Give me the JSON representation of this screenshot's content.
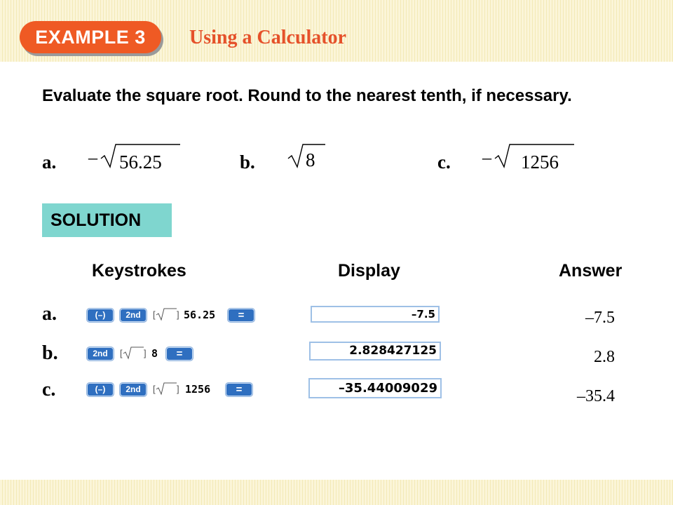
{
  "header": {
    "example_label": "EXAMPLE 3",
    "title": "Using a Calculator"
  },
  "instructions": "Evaluate the square root. Round to the nearest tenth, if necessary.",
  "problems": [
    {
      "letter": "a.",
      "sign": "–",
      "radicand": "56.25"
    },
    {
      "letter": "b.",
      "sign": "",
      "radicand": "8"
    },
    {
      "letter": "c.",
      "sign": "–",
      "radicand": "1256"
    }
  ],
  "solution_label": "SOLUTION",
  "columns": {
    "keystrokes": "Keystrokes",
    "display": "Display",
    "answer": "Answer"
  },
  "rows": [
    {
      "letter": "a.",
      "keys": {
        "neg": "(–)",
        "second": "2nd",
        "bracket_open": "[",
        "bracket_close": "]",
        "number": "56.25",
        "equals": "="
      },
      "display": "–7.5",
      "answer": "–7.5"
    },
    {
      "letter": "b.",
      "keys": {
        "second": "2nd",
        "bracket_open": "[",
        "bracket_close": "]",
        "number": "8",
        "equals": "="
      },
      "display": "2.828427125",
      "answer": "2.8"
    },
    {
      "letter": "c.",
      "keys": {
        "neg": "(–)",
        "second": "2nd",
        "bracket_open": "[",
        "bracket_close": "]",
        "number": "1256",
        "equals": "="
      },
      "display": "–35.44009029",
      "answer": "–35.4"
    }
  ],
  "colors": {
    "accent_orange": "#ef5a24",
    "title_orange": "#e5512a",
    "solution_teal": "#7fd6cf",
    "key_blue": "#2f6fc0"
  }
}
